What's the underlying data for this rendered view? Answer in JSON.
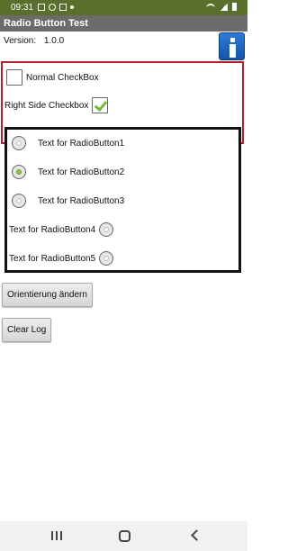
{
  "status_bar": {
    "time": "09:31",
    "icons_left": [
      "image-icon",
      "brightness-icon",
      "video-icon",
      "dot-icon"
    ],
    "icons_right": [
      "wifi-icon",
      "signal-icon",
      "battery-icon"
    ]
  },
  "app": {
    "title": "Radio Button Test",
    "version_label": "Version:",
    "version_value": "1.0.0",
    "info_icon": "info-icon"
  },
  "checkboxes": {
    "normal": {
      "label": "Normal CheckBox",
      "checked": false
    },
    "right_side": {
      "label": "Right Side Checkbox",
      "checked": true
    }
  },
  "radio_buttons": [
    {
      "label": "Text for RadioButton1",
      "selected": false,
      "text_side": "right"
    },
    {
      "label": "Text for RadioButton2",
      "selected": true,
      "text_side": "right"
    },
    {
      "label": "Text for RadioButton3",
      "selected": false,
      "text_side": "right"
    },
    {
      "label": "Text for RadioButton4",
      "selected": false,
      "text_side": "left"
    },
    {
      "label": "Text for RadioButton5",
      "selected": false,
      "text_side": "left"
    }
  ],
  "buttons": {
    "orientation": "Orientierung ändern",
    "clear_log": "Clear Log"
  },
  "colors": {
    "status_bar": "#5a6f2c",
    "title_bar": "#6b6b6b",
    "checkbox_panel_border": "#b5202a",
    "accent_check": "#7ab63c",
    "radio_selected": "#8cc63f",
    "info_icon": "#1e66c4"
  },
  "navigation": [
    "recents-icon",
    "home-icon",
    "back-icon"
  ]
}
